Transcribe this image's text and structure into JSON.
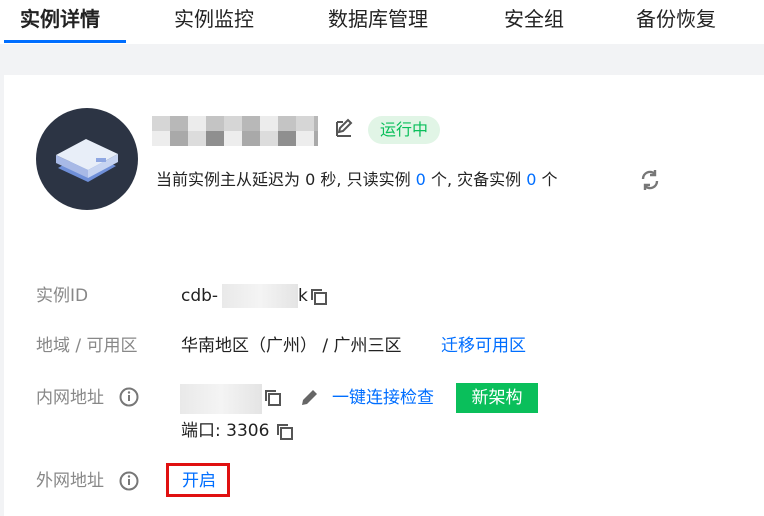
{
  "tabs": [
    {
      "label": "实例详情",
      "active": true
    },
    {
      "label": "实例监控",
      "active": false
    },
    {
      "label": "数据库管理",
      "active": false
    },
    {
      "label": "安全组",
      "active": false
    },
    {
      "label": "备份恢复",
      "active": false
    }
  ],
  "instance": {
    "status": "运行中",
    "summary": {
      "prefix": "当前实例主从延迟为",
      "delay": "0",
      "unit_sec": "秒, 只读实例",
      "readonly_count": "0",
      "unit_ge1": "个, 灾备实例",
      "dr_count": "0",
      "unit_ge2": "个"
    }
  },
  "fields": {
    "id_label": "实例ID",
    "id_prefix": "cdb-",
    "id_suffix": "k",
    "region_label": "地域 / 可用区",
    "region_value": "华南地区（广州） / 广州三区",
    "migrate_link": "迁移可用区",
    "private_label": "内网地址",
    "connect_check": "一键连接检查",
    "new_arch": "新架构",
    "port": "端口: 3306",
    "public_label": "外网地址",
    "open_link": "开启"
  },
  "colors": {
    "accent": "#006eff",
    "success": "#0abf5b",
    "highlight": "#e01010"
  },
  "icons": [
    "edit-icon",
    "refresh-icon",
    "copy-icon",
    "info-icon",
    "pencil-icon",
    "database-icon"
  ]
}
